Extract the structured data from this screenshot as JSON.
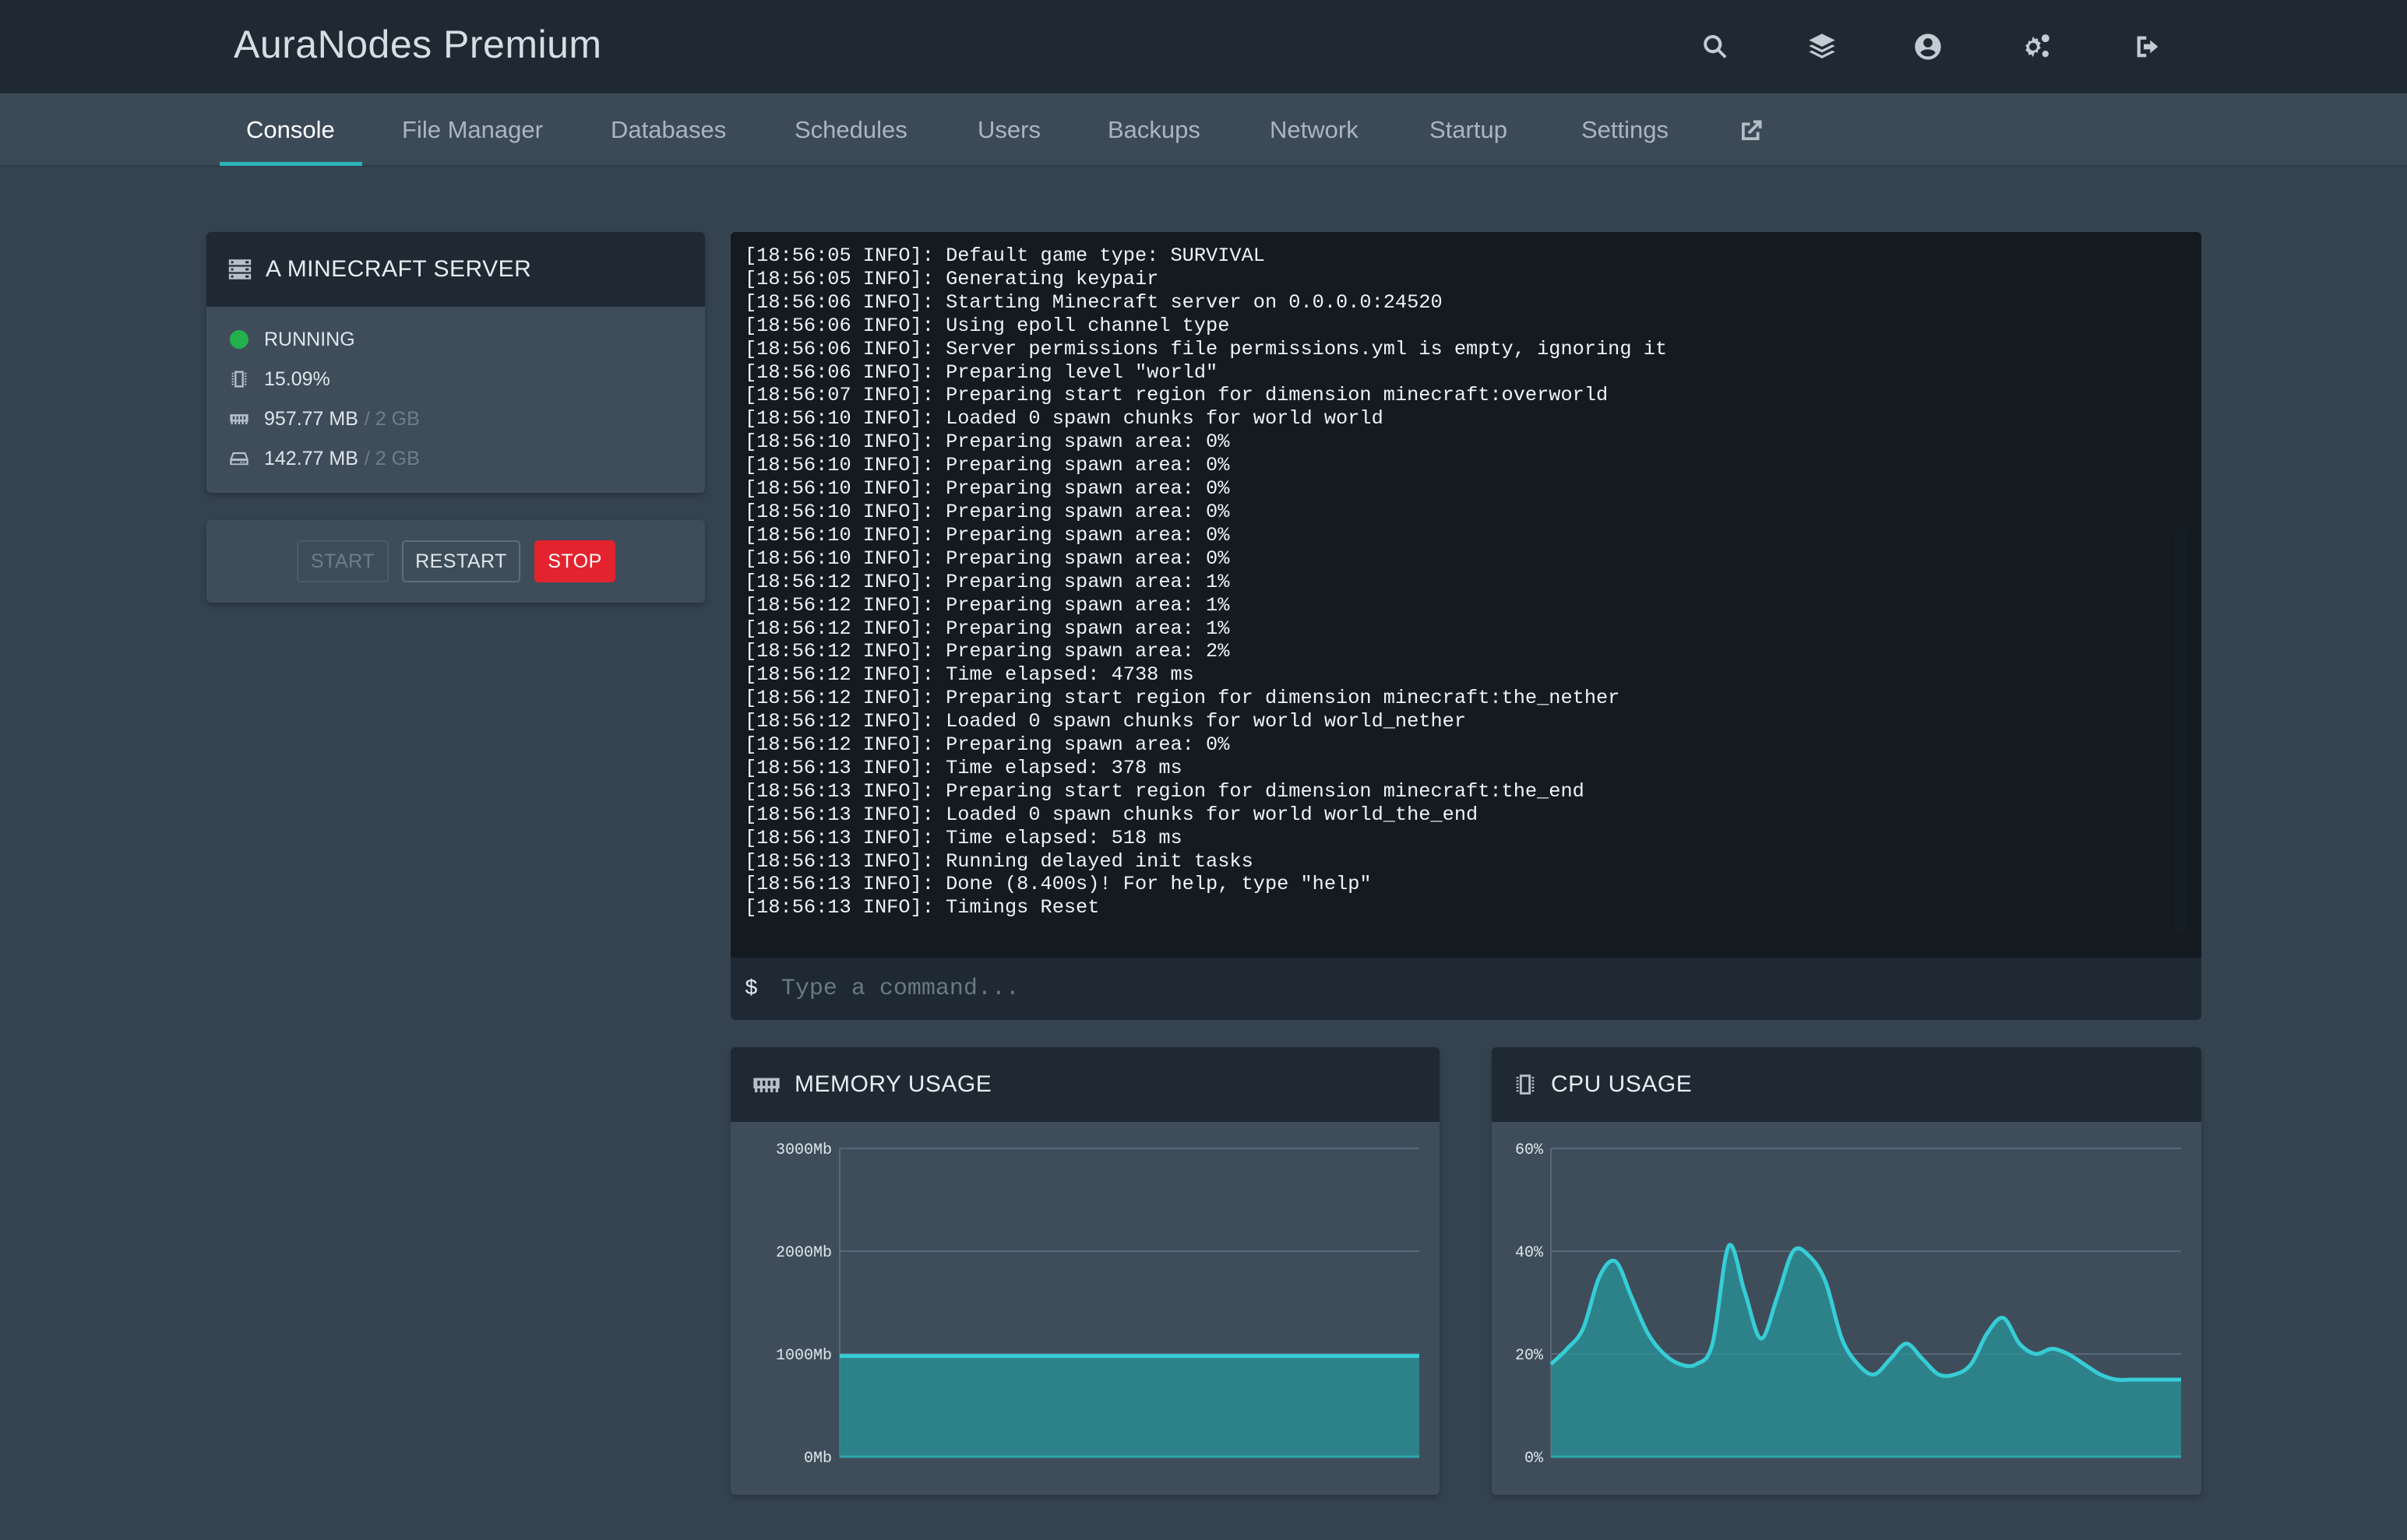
{
  "app": {
    "title": "AuraNodes Premium"
  },
  "top_icons": [
    "search-icon",
    "layers-icon",
    "user-circle-icon",
    "cogs-icon",
    "sign-out-icon"
  ],
  "tabs": [
    {
      "label": "Console",
      "active": true
    },
    {
      "label": "File Manager"
    },
    {
      "label": "Databases"
    },
    {
      "label": "Schedules"
    },
    {
      "label": "Users"
    },
    {
      "label": "Backups"
    },
    {
      "label": "Network"
    },
    {
      "label": "Startup"
    },
    {
      "label": "Settings"
    }
  ],
  "server": {
    "name": "A MINECRAFT SERVER",
    "status": "RUNNING",
    "cpu": "15.09%",
    "memory": "957.77 MB",
    "memory_limit": "/ 2 GB",
    "disk": "142.77 MB",
    "disk_limit": "/ 2 GB"
  },
  "controls": {
    "start": "START",
    "restart": "RESTART",
    "stop": "STOP"
  },
  "console": {
    "lines": [
      "[18:56:05 INFO]: Default game type: SURVIVAL",
      "[18:56:05 INFO]: Generating keypair",
      "[18:56:06 INFO]: Starting Minecraft server on 0.0.0.0:24520",
      "[18:56:06 INFO]: Using epoll channel type",
      "[18:56:06 INFO]: Server permissions file permissions.yml is empty, ignoring it",
      "[18:56:06 INFO]: Preparing level \"world\"",
      "[18:56:07 INFO]: Preparing start region for dimension minecraft:overworld",
      "[18:56:10 INFO]: Loaded 0 spawn chunks for world world",
      "[18:56:10 INFO]: Preparing spawn area: 0%",
      "[18:56:10 INFO]: Preparing spawn area: 0%",
      "[18:56:10 INFO]: Preparing spawn area: 0%",
      "[18:56:10 INFO]: Preparing spawn area: 0%",
      "[18:56:10 INFO]: Preparing spawn area: 0%",
      "[18:56:10 INFO]: Preparing spawn area: 0%",
      "[18:56:12 INFO]: Preparing spawn area: 1%",
      "[18:56:12 INFO]: Preparing spawn area: 1%",
      "[18:56:12 INFO]: Preparing spawn area: 1%",
      "[18:56:12 INFO]: Preparing spawn area: 2%",
      "[18:56:12 INFO]: Time elapsed: 4738 ms",
      "[18:56:12 INFO]: Preparing start region for dimension minecraft:the_nether",
      "[18:56:12 INFO]: Loaded 0 spawn chunks for world world_nether",
      "[18:56:12 INFO]: Preparing spawn area: 0%",
      "[18:56:13 INFO]: Time elapsed: 378 ms",
      "[18:56:13 INFO]: Preparing start region for dimension minecraft:the_end",
      "[18:56:13 INFO]: Loaded 0 spawn chunks for world world_the_end",
      "[18:56:13 INFO]: Time elapsed: 518 ms",
      "[18:56:13 INFO]: Running delayed init tasks",
      "[18:56:13 INFO]: Done (8.400s)! For help, type \"help\"",
      "[18:56:13 INFO]: Timings Reset"
    ],
    "prompt": "$",
    "placeholder": "Type a command..."
  },
  "memory_panel": {
    "title": "MEMORY USAGE"
  },
  "cpu_panel": {
    "title": "CPU USAGE"
  },
  "colors": {
    "accent": "#2bb3b9",
    "line": "#36cdd6",
    "stop": "#e3242f",
    "running": "#22b14c"
  },
  "chart_data": [
    {
      "type": "area",
      "title": "MEMORY USAGE",
      "yticks": [
        "0Mb",
        "1000Mb",
        "2000Mb",
        "3000Mb"
      ],
      "ylim": [
        0,
        3000
      ],
      "x": [
        0,
        1,
        2,
        3,
        4,
        5,
        6,
        7,
        8,
        9,
        10,
        11,
        12,
        13,
        14,
        15,
        16,
        17,
        18,
        19,
        20
      ],
      "series": [
        {
          "values": [
            980,
            980,
            980,
            980,
            980,
            980,
            980,
            980,
            980,
            980,
            980,
            980,
            980,
            980,
            980,
            980,
            980,
            980,
            980,
            980,
            980
          ]
        }
      ]
    },
    {
      "type": "area",
      "title": "CPU USAGE",
      "yticks": [
        "0%",
        "20%",
        "40%",
        "60%"
      ],
      "ylim": [
        0,
        60
      ],
      "x": [
        0,
        1,
        2,
        3,
        4,
        5,
        6,
        7,
        8,
        9,
        10,
        11,
        12,
        13,
        14,
        15,
        16,
        17,
        18,
        19,
        20,
        21,
        22,
        23,
        24,
        25,
        26,
        27,
        28,
        29,
        30,
        31,
        32,
        33,
        34,
        35,
        36,
        37,
        38,
        39
      ],
      "series": [
        {
          "values": [
            18,
            21,
            25,
            35,
            38,
            31,
            24,
            20,
            18,
            18,
            22,
            41,
            32,
            23,
            31,
            40,
            39,
            34,
            23,
            18,
            16,
            19,
            22,
            19,
            16,
            16,
            18,
            24,
            27,
            22,
            20,
            21,
            20,
            18,
            16,
            15,
            15,
            15,
            15,
            15
          ]
        }
      ]
    }
  ]
}
